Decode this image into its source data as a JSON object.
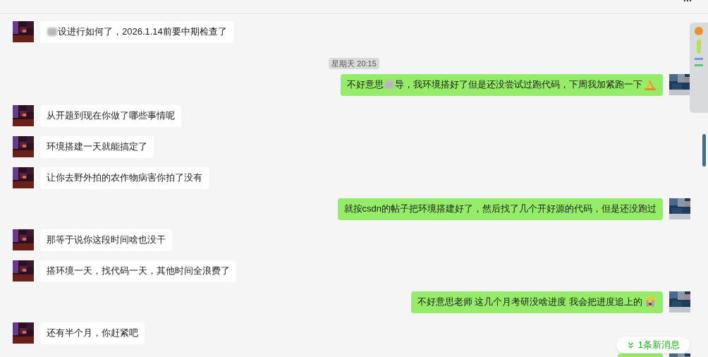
{
  "messages": [
    {
      "kind": "received",
      "parts": [
        {
          "kind": "blur"
        },
        {
          "kind": "text",
          "text": "设进行如何了，2026.1.14前要中期检查了"
        }
      ]
    },
    {
      "kind": "time",
      "text": "星期天 20:15"
    },
    {
      "kind": "sent",
      "parts": [
        {
          "kind": "text",
          "text": "不好意思"
        },
        {
          "kind": "blur"
        },
        {
          "kind": "text",
          "text": "导，我环境搭好了但是还没尝试过跑代码，下周我加紧跑一下"
        },
        {
          "kind": "emoji-hands"
        }
      ]
    },
    {
      "kind": "received",
      "parts": [
        {
          "kind": "text",
          "text": "从开题到现在你做了哪些事情呢"
        }
      ]
    },
    {
      "kind": "received",
      "parts": [
        {
          "kind": "text",
          "text": "环境搭建一天就能搞定了"
        }
      ]
    },
    {
      "kind": "received",
      "parts": [
        {
          "kind": "text",
          "text": "让你去野外拍的农作物病害你拍了没有"
        }
      ]
    },
    {
      "kind": "sent",
      "parts": [
        {
          "kind": "text",
          "text": "就按csdn的帖子把环境搭建好了，然后找了几个开好源的代码，但是还没跑过"
        }
      ]
    },
    {
      "kind": "received",
      "parts": [
        {
          "kind": "text",
          "text": "那等于说你这段时间啥也没干"
        }
      ]
    },
    {
      "kind": "received",
      "parts": [
        {
          "kind": "text",
          "text": "搭环境一天，找代码一天，其他时间全浪费了"
        }
      ]
    },
    {
      "kind": "sent",
      "parts": [
        {
          "kind": "text",
          "text": "不好意思老师 这几个月考研没啥进度 我会把进度追上的"
        },
        {
          "kind": "emoji-crying"
        }
      ]
    },
    {
      "kind": "received",
      "parts": [
        {
          "kind": "text",
          "text": "还有半个月，你赶紧吧"
        }
      ]
    },
    {
      "kind": "sent"
    }
  ],
  "new_messages": {
    "text": "1条新消息"
  }
}
